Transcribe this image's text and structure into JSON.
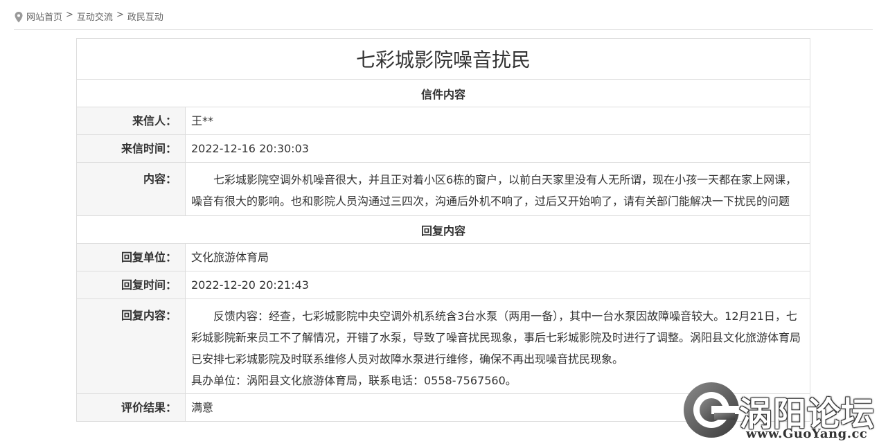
{
  "breadcrumb": {
    "items": [
      "网站首页",
      "互动交流",
      "政民互动"
    ],
    "separator": ">"
  },
  "letter": {
    "title": "七彩城影院噪音扰民",
    "section_letter": "信件内容",
    "sender_label": "来信人：",
    "sender_value": "王**",
    "time_label": "来信时间：",
    "time_value": "2022-12-16 20:30:03",
    "content_label": "内容：",
    "content_value": "七彩城影院空调外机噪音很大，并且正对着小区6栋的窗户，以前白天家里没有人无所谓，现在小孩一天都在家上网课，噪音有很大的影响。也和影院人员沟通过三四次，沟通后外机不响了，过后又开始响了，请有关部门能解决一下扰民的问题"
  },
  "reply": {
    "section_reply": "回复内容",
    "unit_label": "回复单位：",
    "unit_value": "文化旅游体育局",
    "time_label": "回复时间：",
    "time_value": "2022-12-20 20:21:43",
    "content_label": "回复内容：",
    "content_para": "反馈内容：经查，七彩城影院中央空调外机系统含3台水泵（两用一备），其中一台水泵因故障噪音较大。12月21日，七彩城影院新来员工不了解情况，开错了水泵，导致了噪音扰民现象，事后七彩城影院及时进行了调整。涡阳县文化旅游体育局已安排七彩城影院及时联系维修人员对故障水泵进行维修，确保不再出现噪音扰民现象。",
    "content_contact": "具办单位：涡阳县文化旅游体育局，联系电话：0558-7567560。",
    "rating_label": "评价结果：",
    "rating_value": "满意"
  },
  "watermark": {
    "brand": "涡阳论坛",
    "url": "www.GuoYang.cc"
  },
  "icons": {
    "location": "location-pin-icon",
    "logo": "g-logo-icon"
  },
  "colors": {
    "border": "#dddddd",
    "label_bg": "#f6f6f6",
    "text": "#333333",
    "breadcrumb_text": "#666666"
  }
}
